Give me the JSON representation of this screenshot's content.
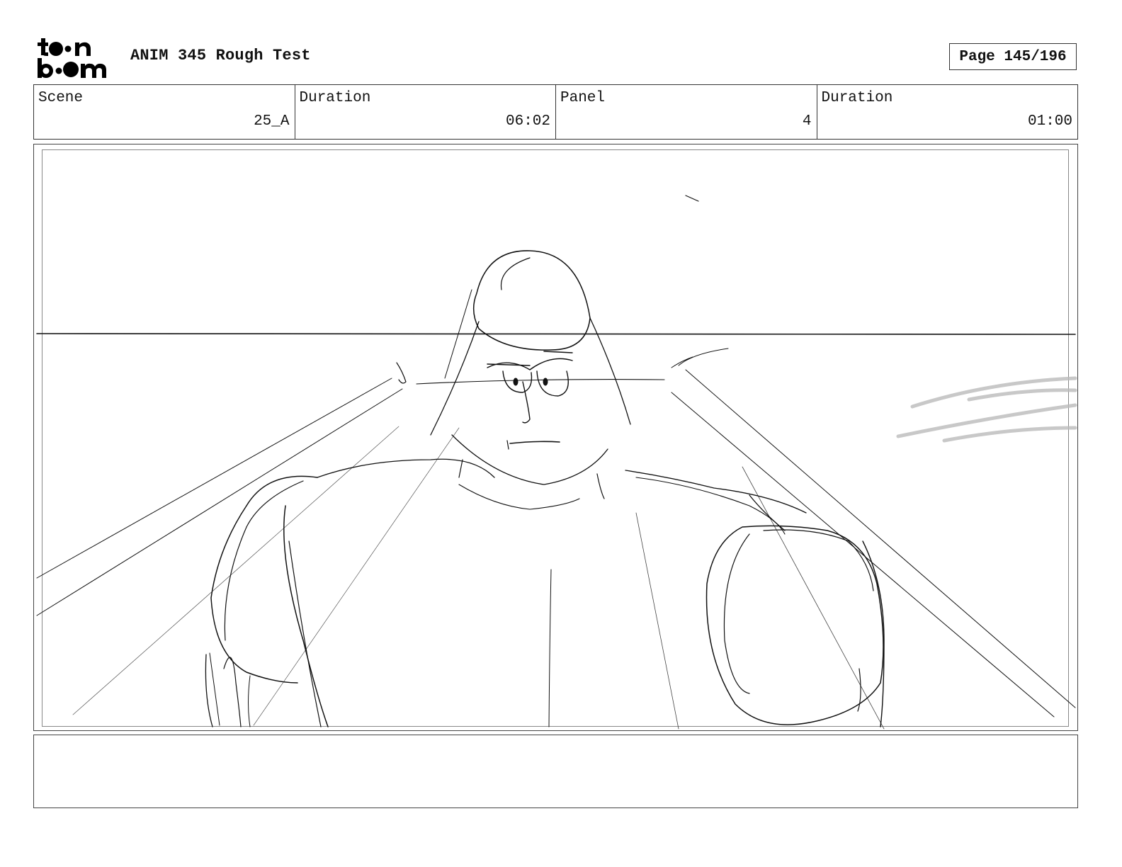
{
  "header": {
    "logo_text": "toon boom",
    "title": "ANIM 345 Rough Test",
    "page": "Page 145/196"
  },
  "info": [
    {
      "label": "Scene",
      "value": "25_A"
    },
    {
      "label": "Duration",
      "value": "06:02"
    },
    {
      "label": "Panel",
      "value": "4"
    },
    {
      "label": "Duration",
      "value": "01:00"
    }
  ],
  "panel": {
    "image": "rough-sketch-muscular-character-with-glasses"
  },
  "notes": {
    "text": ""
  }
}
